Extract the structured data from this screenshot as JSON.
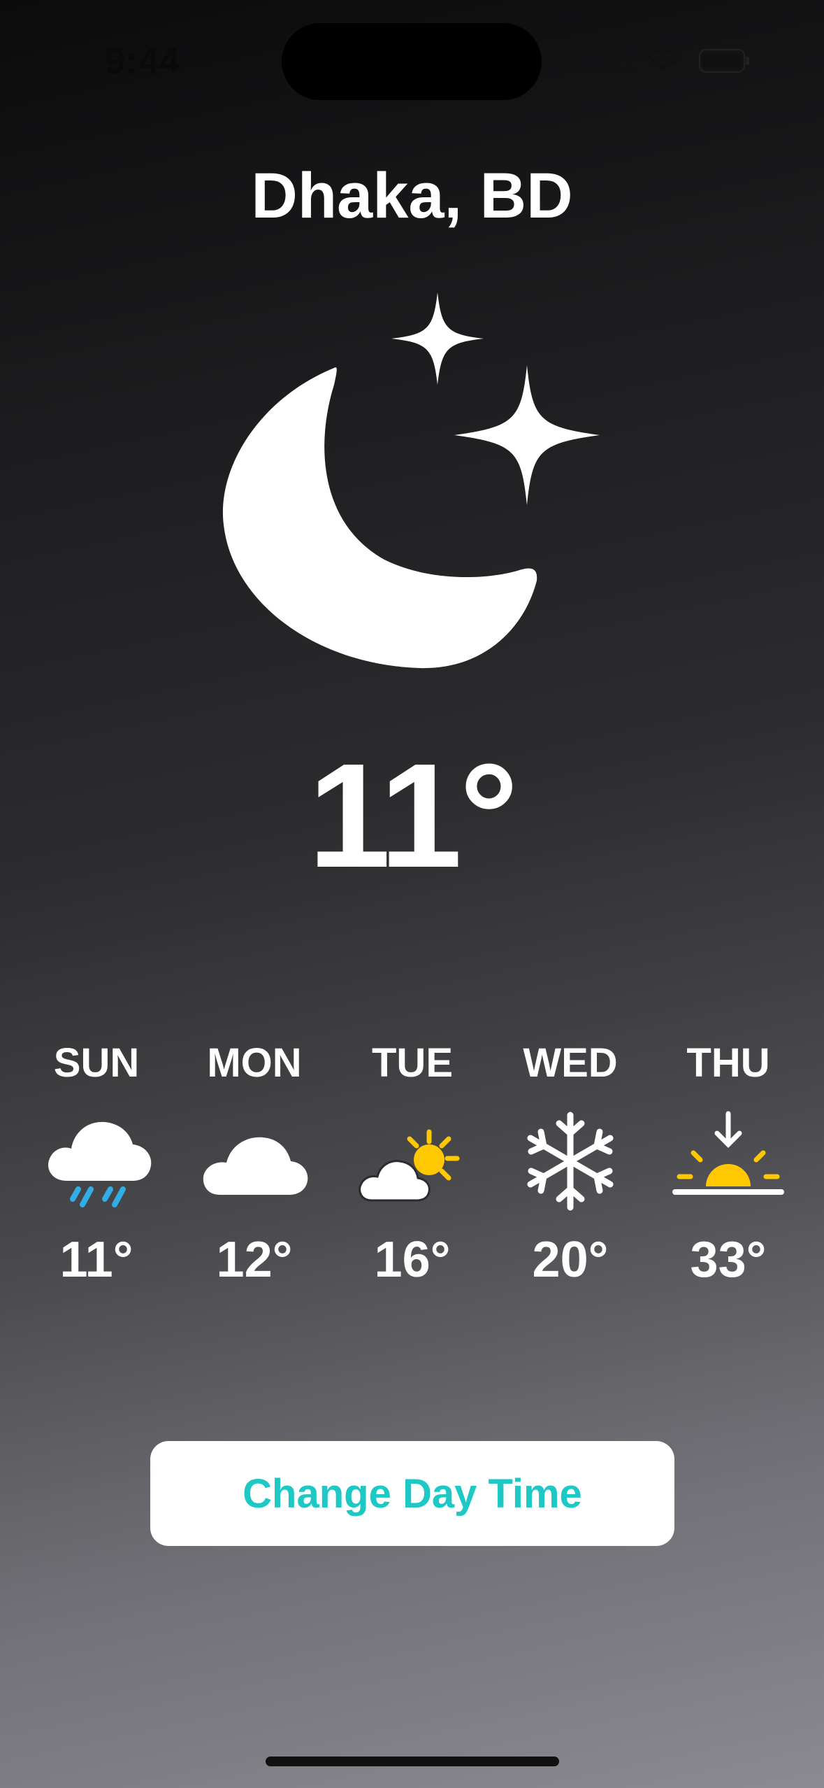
{
  "status_bar": {
    "time": "9:44",
    "signal_icon": "cellular-signal-icon",
    "wifi_icon": "wifi-icon",
    "battery_icon": "battery-icon"
  },
  "city": "Dhaka, BD",
  "current": {
    "icon": "moon-stars-icon",
    "temperature": "11°"
  },
  "forecast": [
    {
      "day": "SUN",
      "icon": "cloud-rain-icon",
      "temperature": "11°"
    },
    {
      "day": "MON",
      "icon": "cloud-icon",
      "temperature": "12°"
    },
    {
      "day": "TUE",
      "icon": "cloud-sun-icon",
      "temperature": "16°"
    },
    {
      "day": "WED",
      "icon": "snowflake-icon",
      "temperature": "20°"
    },
    {
      "day": "THU",
      "icon": "sunset-icon",
      "temperature": "33°"
    }
  ],
  "button": {
    "label": "Change Day Time"
  },
  "colors": {
    "accent": "#1ec8c4",
    "rain": "#32aee6",
    "sun": "#ffc800",
    "text": "#ffffff"
  }
}
